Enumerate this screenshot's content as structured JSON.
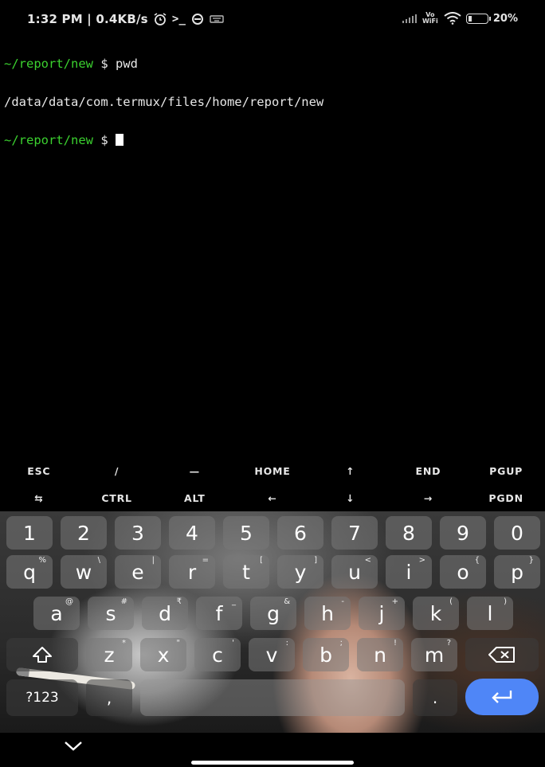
{
  "status_bar": {
    "time_speed": "1:32 PM | 0.4KB/s",
    "volte": "Vo WiFi",
    "battery": "20%",
    "battery_level": 0.2
  },
  "terminal": {
    "lines": [
      {
        "path": "~/report/new",
        "cmd": " $ pwd"
      },
      {
        "output": "/data/data/com.termux/files/home/report/new"
      },
      {
        "path": "~/report/new",
        "cmd": " $ "
      }
    ]
  },
  "extra_keys": {
    "row1": [
      "ESC",
      "/",
      "—",
      "HOME",
      "↑",
      "END",
      "PGUP"
    ],
    "row2": [
      "⇆",
      "CTRL",
      "ALT",
      "←",
      "↓",
      "→",
      "PGDN"
    ]
  },
  "keyboard": {
    "numbers": [
      "1",
      "2",
      "3",
      "4",
      "5",
      "6",
      "7",
      "8",
      "9",
      "0"
    ],
    "row_q": [
      {
        "k": "q",
        "s": "%"
      },
      {
        "k": "w",
        "s": "\\"
      },
      {
        "k": "e",
        "s": "|"
      },
      {
        "k": "r",
        "s": "="
      },
      {
        "k": "t",
        "s": "["
      },
      {
        "k": "y",
        "s": "]"
      },
      {
        "k": "u",
        "s": "<"
      },
      {
        "k": "i",
        "s": ">"
      },
      {
        "k": "o",
        "s": "{"
      },
      {
        "k": "p",
        "s": "}"
      }
    ],
    "row_a": [
      {
        "k": "a",
        "s": "@"
      },
      {
        "k": "s",
        "s": "#"
      },
      {
        "k": "d",
        "s": "₹"
      },
      {
        "k": "f",
        "s": "_"
      },
      {
        "k": "g",
        "s": "&"
      },
      {
        "k": "h",
        "s": "-"
      },
      {
        "k": "j",
        "s": "+"
      },
      {
        "k": "k",
        "s": "("
      },
      {
        "k": "l",
        "s": ")"
      }
    ],
    "row_z": [
      {
        "k": "z",
        "s": "*"
      },
      {
        "k": "x",
        "s": "\""
      },
      {
        "k": "c",
        "s": "'"
      },
      {
        "k": "v",
        "s": ":"
      },
      {
        "k": "b",
        "s": ";"
      },
      {
        "k": "n",
        "s": "!"
      },
      {
        "k": "m",
        "s": "?"
      }
    ],
    "symbols_label": "?123",
    "comma": ",",
    "period": "."
  }
}
